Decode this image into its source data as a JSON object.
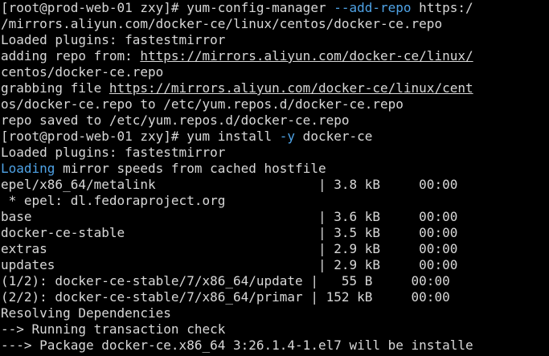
{
  "terminal": {
    "lines": [
      [
        {
          "t": "[root@prod-web-01 zxy]# yum-config-manager "
        },
        {
          "t": "--add-repo",
          "c": "opt"
        },
        {
          "t": " https:/"
        }
      ],
      [
        {
          "t": "/mirrors.aliyun.com/docker-ce/linux/centos/docker-ce.repo"
        }
      ],
      [
        {
          "t": "Loaded plugins: fastestmirror"
        }
      ],
      [
        {
          "t": "adding repo from: "
        },
        {
          "t": "https://mirrors.aliyun.com/docker-ce/linux/",
          "c": "url"
        }
      ],
      [
        {
          "t": "centos/docker-ce.repo"
        }
      ],
      [
        {
          "t": "grabbing file "
        },
        {
          "t": "https://mirrors.aliyun.com/docker-ce/linux/cent",
          "c": "url"
        }
      ],
      [
        {
          "t": "os/docker-ce.repo to /etc/yum.repos.d/docker-ce.repo"
        }
      ],
      [
        {
          "t": "repo saved to /etc/yum.repos.d/docker-ce.repo"
        }
      ],
      [
        {
          "t": "[root@prod-web-01 zxy]# yum install "
        },
        {
          "t": "-y",
          "c": "opt"
        },
        {
          "t": " docker-ce"
        }
      ],
      [
        {
          "t": "Loaded plugins: fastestmirror"
        }
      ],
      [
        {
          "t": "Loading",
          "c": "kw"
        },
        {
          "t": " mirror speeds from cached hostfile"
        }
      ],
      [
        {
          "t": "epel/x86_64/metalink                     | 3.8 kB     00:00"
        }
      ],
      [
        {
          "t": " * epel: dl.fedoraproject.org"
        }
      ],
      [
        {
          "t": "base                                     | 3.6 kB     00:00"
        }
      ],
      [
        {
          "t": "docker-ce-stable                         | 3.5 kB     00:00"
        }
      ],
      [
        {
          "t": "extras                                   | 2.9 kB     00:00"
        }
      ],
      [
        {
          "t": "updates                                  | 2.9 kB     00:00"
        }
      ],
      [
        {
          "t": "(1/2): docker-ce-stable/7/x86_64/update |   55 B     00:00"
        }
      ],
      [
        {
          "t": "(2/2): docker-ce-stable/7/x86_64/primar | 152 kB     00:00"
        }
      ],
      [
        {
          "t": "Resolving Dependencies"
        }
      ],
      [
        {
          "t": "--> Running transaction check"
        }
      ],
      [
        {
          "t": "---> Package docker-ce.x86_64 3:26.1.4-1.el7 will be installe"
        }
      ]
    ]
  },
  "colors": {
    "background": "#000000",
    "foreground": "#d8d8d8",
    "option_highlight": "#4fa3e6"
  }
}
